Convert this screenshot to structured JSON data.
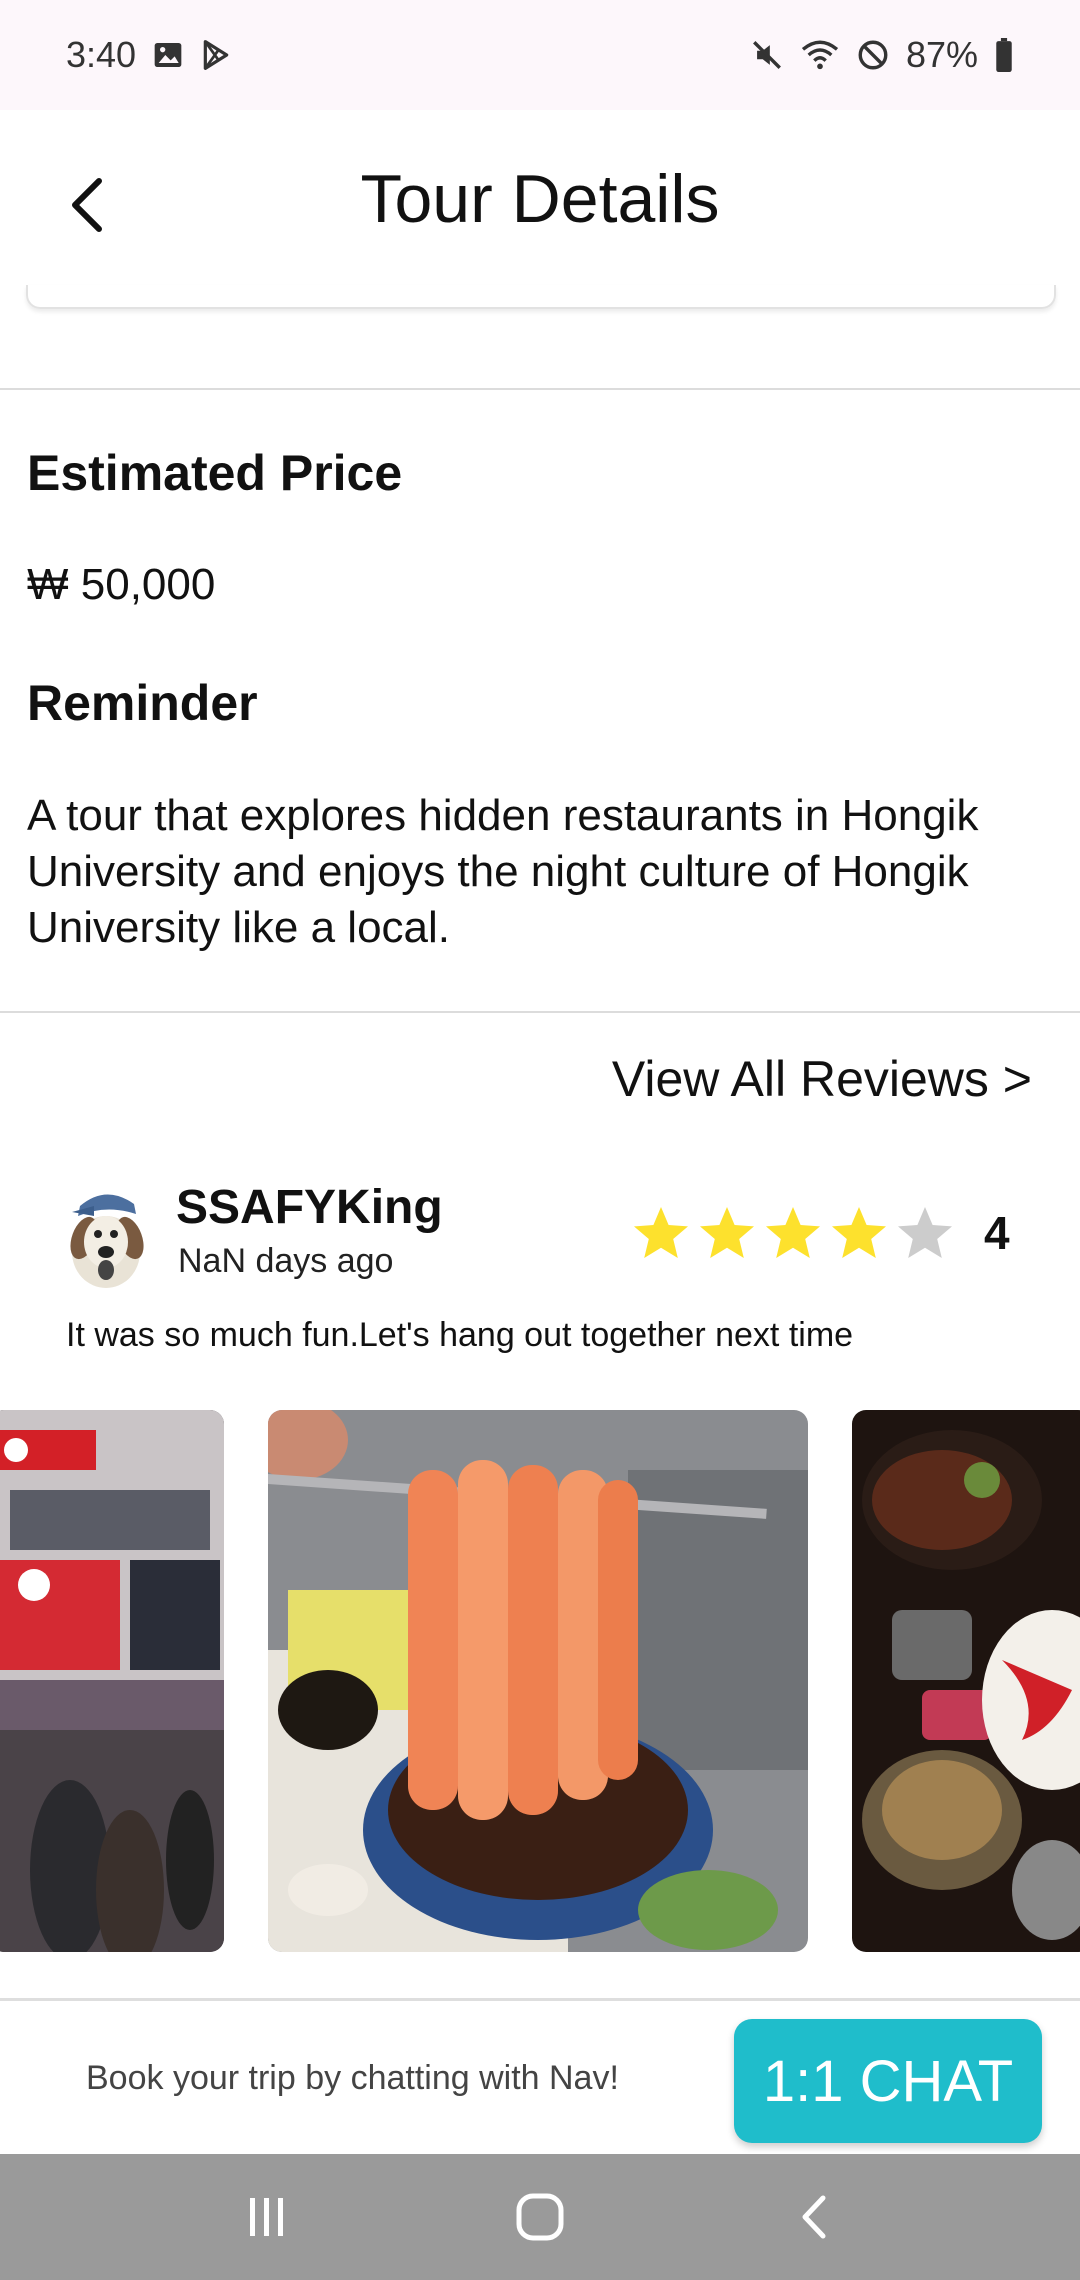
{
  "status_bar": {
    "time": "3:40",
    "battery": "87%",
    "icons_left": [
      "image-icon",
      "play-store-icon"
    ],
    "icons_right": [
      "mute-icon",
      "wifi-icon",
      "do-not-disturb-icon",
      "battery-icon"
    ]
  },
  "header": {
    "title": "Tour Details",
    "back_icon": "chevron-left-icon"
  },
  "estimated_price": {
    "title": "Estimated Price",
    "value": "₩ 50,000"
  },
  "reminder": {
    "title": "Reminder",
    "text": "A tour that explores hidden restaurants in Hongik University and enjoys the night culture of Hongik University like a local."
  },
  "reviews": {
    "view_all_label": "View All Reviews >",
    "items": [
      {
        "name": "SSAFYKing",
        "date": "NaN days ago",
        "rating": 4,
        "rating_label": "4",
        "max_rating": 5,
        "text": "It was so much fun.Let's hang out together next time",
        "photos": [
          "street-night-photo",
          "salmon-dish-photo",
          "steak-dinner-photo"
        ]
      }
    ]
  },
  "bottom_bar": {
    "prompt": "Book your trip by chatting with Nav!",
    "chat_label": "1:1 CHAT"
  },
  "colors": {
    "accent": "#1fbdcb",
    "star_filled": "#fde12d",
    "star_empty": "#cccccc",
    "nav_bar": "#9a9a9a",
    "status_bar": "#fdf7fb"
  }
}
